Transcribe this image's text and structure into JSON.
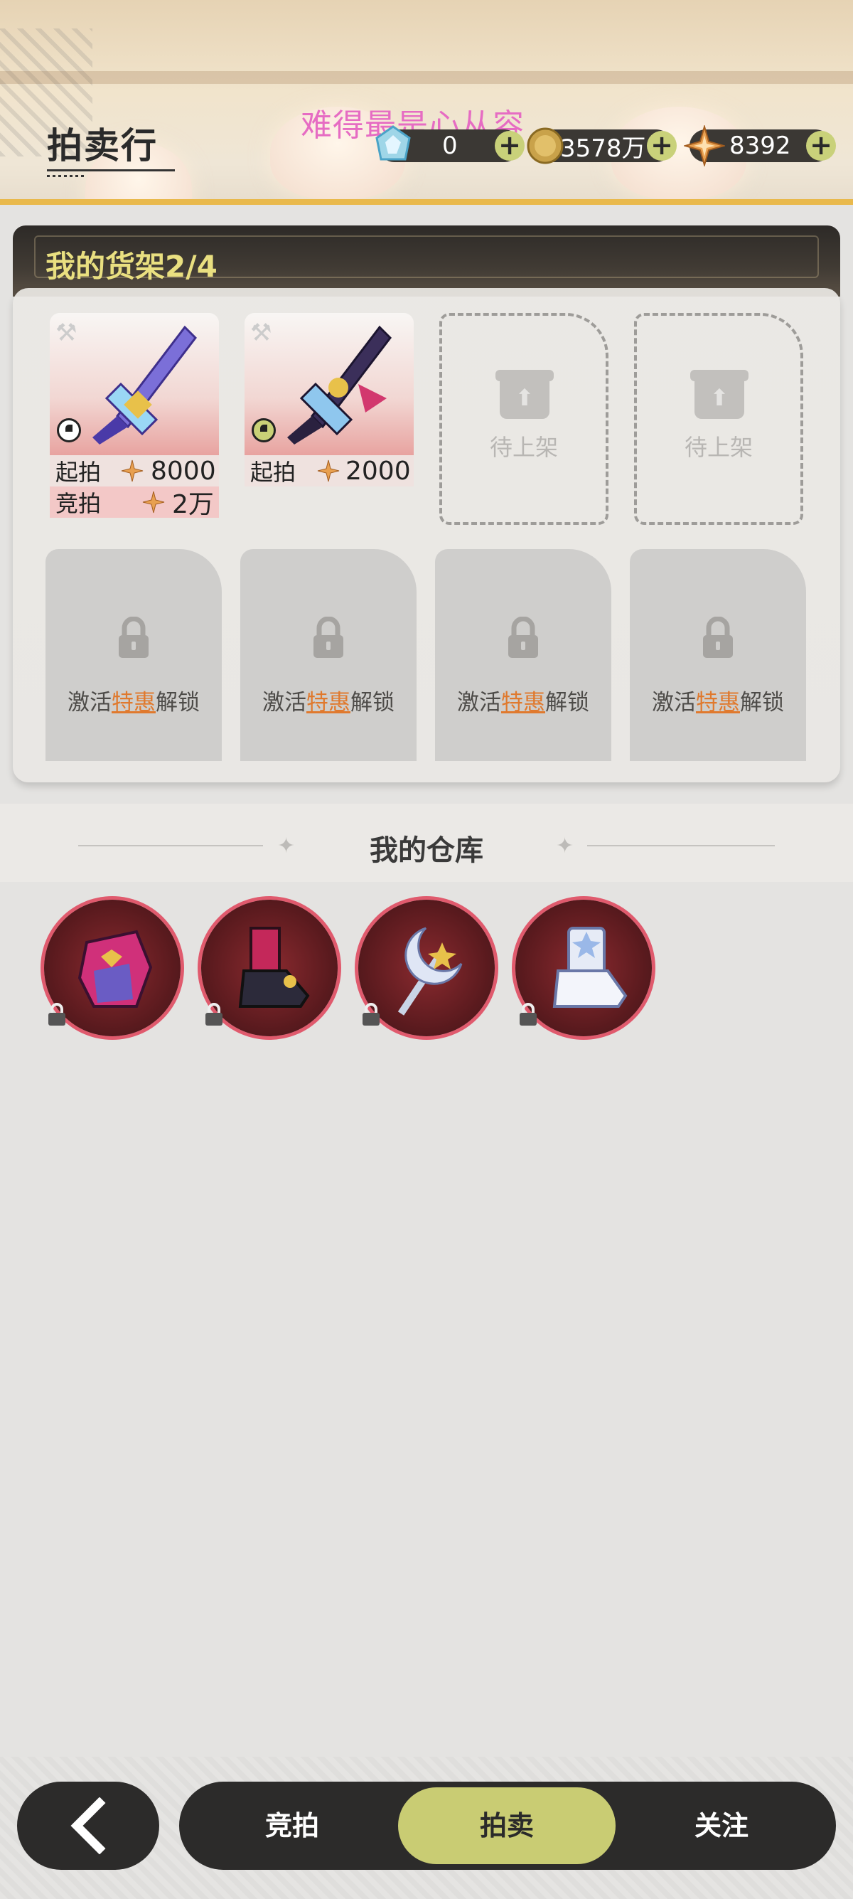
{
  "header": {
    "title": "拍卖行",
    "watermark": "难得最是心从容",
    "resources": [
      {
        "icon": "crystal-icon",
        "value": "0"
      },
      {
        "icon": "gold-coin-icon",
        "value": "3578万"
      },
      {
        "icon": "star-gem-icon",
        "value": "8392"
      }
    ]
  },
  "shelf": {
    "title": "我的货架2/4",
    "items": [
      {
        "icon": "sword-purple-icon",
        "start_label": "起拍",
        "start_value": "8000",
        "bid_label": "竞拍",
        "bid_value": "2万"
      },
      {
        "icon": "sword-dark-icon",
        "start_label": "起拍",
        "start_value": "2000"
      }
    ],
    "empty_slots": [
      "待上架",
      "待上架"
    ],
    "locked_slots": [
      {
        "pre": "激活",
        "highlight": "特惠",
        "post": "解锁"
      },
      {
        "pre": "激活",
        "highlight": "特惠",
        "post": "解锁"
      },
      {
        "pre": "激活",
        "highlight": "特惠",
        "post": "解锁"
      },
      {
        "pre": "激活",
        "highlight": "特惠",
        "post": "解锁"
      }
    ]
  },
  "warehouse": {
    "title": "我的仓库",
    "items": [
      "gauntlet-icon",
      "boots-dark-icon",
      "moon-staff-icon",
      "boots-white-icon"
    ]
  },
  "nav": {
    "back_icon": "chevron-left-icon",
    "tabs": [
      "竞拍",
      "拍卖",
      "关注"
    ],
    "active_tab": "拍卖"
  },
  "colors": {
    "accent_yellow": "#c9cc73",
    "highlight_orange": "#e0792d",
    "watermark_pink": "#e66cc3"
  }
}
